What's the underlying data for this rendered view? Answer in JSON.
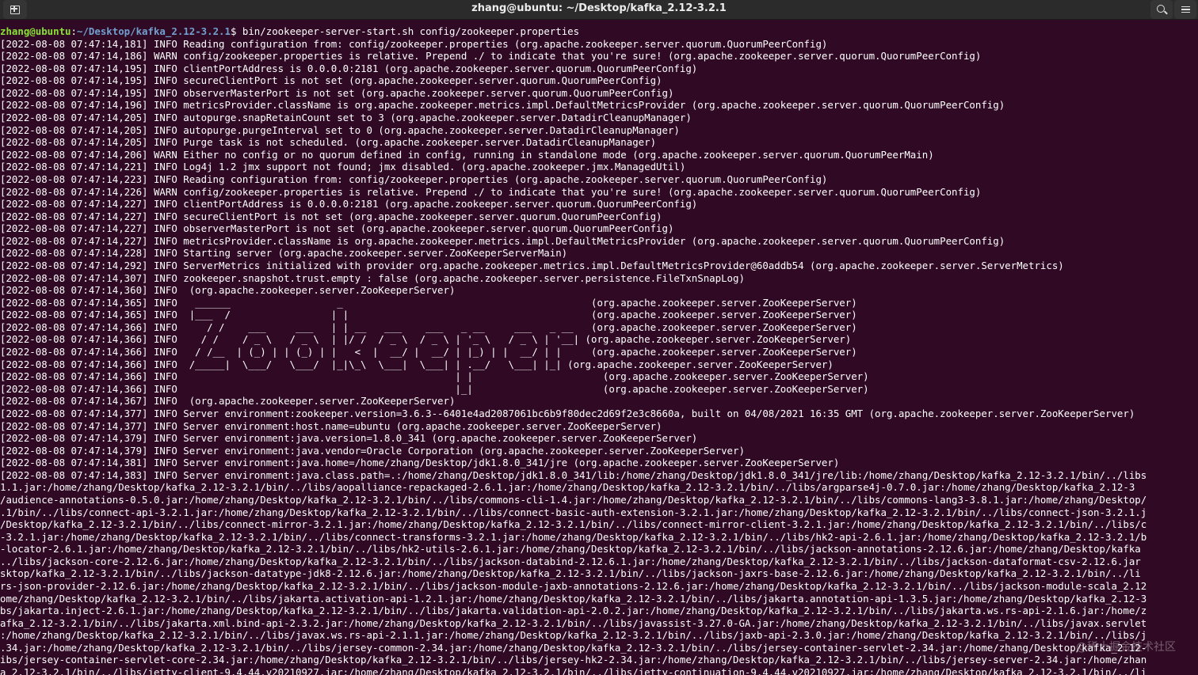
{
  "window": {
    "title": "zhang@ubuntu: ~/Desktop/kafka_2.12-3.2.1",
    "new_tab_icon": "new-tab-icon",
    "search_icon": "search-icon",
    "menu_icon": "hamburger-menu-icon"
  },
  "prompt": {
    "user_host": "zhang@ubuntu",
    "separator": ":",
    "path": "~/Desktop/kafka_2.12-3.2.1",
    "symbol": "$ ",
    "command": "bin/zookeeper-server-start.sh config/zookeeper.properties"
  },
  "colors": {
    "background": "#300a24",
    "prompt_user": "#8ae234",
    "prompt_path": "#729fcf",
    "text": "#ffffff"
  },
  "output_lines": [
    "[2022-08-08 07:47:14,181] INFO Reading configuration from: config/zookeeper.properties (org.apache.zookeeper.server.quorum.QuorumPeerConfig)",
    "[2022-08-08 07:47:14,186] WARN config/zookeeper.properties is relative. Prepend ./ to indicate that you're sure! (org.apache.zookeeper.server.quorum.QuorumPeerConfig)",
    "[2022-08-08 07:47:14,195] INFO clientPortAddress is 0.0.0.0:2181 (org.apache.zookeeper.server.quorum.QuorumPeerConfig)",
    "[2022-08-08 07:47:14,195] INFO secureClientPort is not set (org.apache.zookeeper.server.quorum.QuorumPeerConfig)",
    "[2022-08-08 07:47:14,195] INFO observerMasterPort is not set (org.apache.zookeeper.server.quorum.QuorumPeerConfig)",
    "[2022-08-08 07:47:14,196] INFO metricsProvider.className is org.apache.zookeeper.metrics.impl.DefaultMetricsProvider (org.apache.zookeeper.server.quorum.QuorumPeerConfig)",
    "[2022-08-08 07:47:14,205] INFO autopurge.snapRetainCount set to 3 (org.apache.zookeeper.server.DatadirCleanupManager)",
    "[2022-08-08 07:47:14,205] INFO autopurge.purgeInterval set to 0 (org.apache.zookeeper.server.DatadirCleanupManager)",
    "[2022-08-08 07:47:14,205] INFO Purge task is not scheduled. (org.apache.zookeeper.server.DatadirCleanupManager)",
    "[2022-08-08 07:47:14,206] WARN Either no config or no quorum defined in config, running in standalone mode (org.apache.zookeeper.server.quorum.QuorumPeerMain)",
    "[2022-08-08 07:47:14,221] INFO Log4j 1.2 jmx support not found; jmx disabled. (org.apache.zookeeper.jmx.ManagedUtil)",
    "[2022-08-08 07:47:14,223] INFO Reading configuration from: config/zookeeper.properties (org.apache.zookeeper.server.quorum.QuorumPeerConfig)",
    "[2022-08-08 07:47:14,226] WARN config/zookeeper.properties is relative. Prepend ./ to indicate that you're sure! (org.apache.zookeeper.server.quorum.QuorumPeerConfig)",
    "[2022-08-08 07:47:14,227] INFO clientPortAddress is 0.0.0.0:2181 (org.apache.zookeeper.server.quorum.QuorumPeerConfig)",
    "[2022-08-08 07:47:14,227] INFO secureClientPort is not set (org.apache.zookeeper.server.quorum.QuorumPeerConfig)",
    "[2022-08-08 07:47:14,227] INFO observerMasterPort is not set (org.apache.zookeeper.server.quorum.QuorumPeerConfig)",
    "[2022-08-08 07:47:14,227] INFO metricsProvider.className is org.apache.zookeeper.metrics.impl.DefaultMetricsProvider (org.apache.zookeeper.server.quorum.QuorumPeerConfig)",
    "[2022-08-08 07:47:14,228] INFO Starting server (org.apache.zookeeper.server.ZooKeeperServerMain)",
    "[2022-08-08 07:47:14,292] INFO ServerMetrics initialized with provider org.apache.zookeeper.metrics.impl.DefaultMetricsProvider@60addb54 (org.apache.zookeeper.server.ServerMetrics)",
    "[2022-08-08 07:47:14,307] INFO zookeeper.snapshot.trust.empty : false (org.apache.zookeeper.server.persistence.FileTxnSnapLog)",
    "[2022-08-08 07:47:14,360] INFO  (org.apache.zookeeper.server.ZooKeeperServer)",
    "[2022-08-08 07:47:14,365] INFO   ______                  _                                          (org.apache.zookeeper.server.ZooKeeperServer)",
    "[2022-08-08 07:47:14,365] INFO  |___  /                 | |                                         (org.apache.zookeeper.server.ZooKeeperServer)",
    "[2022-08-08 07:47:14,366] INFO     / /    ___     ___   | | __   ___    ___   _ __     ___   _ __   (org.apache.zookeeper.server.ZooKeeperServer)",
    "[2022-08-08 07:47:14,366] INFO    / /    / _ \\   / _ \\  | |/ /  / _ \\  / _ \\ | '_ \\   / _ \\ | '__| (org.apache.zookeeper.server.ZooKeeperServer)",
    "[2022-08-08 07:47:14,366] INFO   / /__  | (_) | | (_) | |   <  |  __/ |  __/ | |_) | |  __/ | |     (org.apache.zookeeper.server.ZooKeeperServer)",
    "[2022-08-08 07:47:14,366] INFO  /_____|  \\___/   \\___/  |_|\\_\\  \\___|  \\___| | .__/   \\___| |_| (org.apache.zookeeper.server.ZooKeeperServer)",
    "[2022-08-08 07:47:14,366] INFO                                               | |                      (org.apache.zookeeper.server.ZooKeeperServer)",
    "[2022-08-08 07:47:14,366] INFO                                               |_|                      (org.apache.zookeeper.server.ZooKeeperServer)",
    "[2022-08-08 07:47:14,367] INFO  (org.apache.zookeeper.server.ZooKeeperServer)",
    "[2022-08-08 07:47:14,377] INFO Server environment:zookeeper.version=3.6.3--6401e4ad2087061bc6b9f80dec2d69f2e3c8660a, built on 04/08/2021 16:35 GMT (org.apache.zookeeper.server.ZooKeeperServer)",
    "[2022-08-08 07:47:14,377] INFO Server environment:host.name=ubuntu (org.apache.zookeeper.server.ZooKeeperServer)",
    "[2022-08-08 07:47:14,379] INFO Server environment:java.version=1.8.0_341 (org.apache.zookeeper.server.ZooKeeperServer)",
    "[2022-08-08 07:47:14,379] INFO Server environment:java.vendor=Oracle Corporation (org.apache.zookeeper.server.ZooKeeperServer)",
    "[2022-08-08 07:47:14,381] INFO Server environment:java.home=/home/zhang/Desktop/jdk1.8.0_341/jre (org.apache.zookeeper.server.ZooKeeperServer)",
    "[2022-08-08 07:47:14,383] INFO Server environment:java.class.path=.:/home/zhang/Desktop/jdk1.8.0_341/lib:/home/zhang/Desktop/jdk1.8.0_341/jre/lib:/home/zhang/Desktop/kafka_2.12-3.2.1/bin/../libs",
    "1.1.jar:/home/zhang/Desktop/kafka_2.12-3.2.1/bin/../libs/aopalliance-repackaged-2.6.1.jar:/home/zhang/Desktop/kafka_2.12-3.2.1/bin/../libs/argparse4j-0.7.0.jar:/home/zhang/Desktop/kafka_2.12-3",
    "/audience-annotations-0.5.0.jar:/home/zhang/Desktop/kafka_2.12-3.2.1/bin/../libs/commons-cli-1.4.jar:/home/zhang/Desktop/kafka_2.12-3.2.1/bin/../libs/commons-lang3-3.8.1.jar:/home/zhang/Desktop/",
    ".1/bin/../libs/connect-api-3.2.1.jar:/home/zhang/Desktop/kafka_2.12-3.2.1/bin/../libs/connect-basic-auth-extension-3.2.1.jar:/home/zhang/Desktop/kafka_2.12-3.2.1/bin/../libs/connect-json-3.2.1.j",
    "/Desktop/kafka_2.12-3.2.1/bin/../libs/connect-mirror-3.2.1.jar:/home/zhang/Desktop/kafka_2.12-3.2.1/bin/../libs/connect-mirror-client-3.2.1.jar:/home/zhang/Desktop/kafka_2.12-3.2.1/bin/../libs/c",
    "-3.2.1.jar:/home/zhang/Desktop/kafka_2.12-3.2.1/bin/../libs/connect-transforms-3.2.1.jar:/home/zhang/Desktop/kafka_2.12-3.2.1/bin/../libs/hk2-api-2.6.1.jar:/home/zhang/Desktop/kafka_2.12-3.2.1/b",
    "-locator-2.6.1.jar:/home/zhang/Desktop/kafka_2.12-3.2.1/bin/../libs/hk2-utils-2.6.1.jar:/home/zhang/Desktop/kafka_2.12-3.2.1/bin/../libs/jackson-annotations-2.12.6.jar:/home/zhang/Desktop/kafka",
    "../libs/jackson-core-2.12.6.jar:/home/zhang/Desktop/kafka_2.12-3.2.1/bin/../libs/jackson-databind-2.12.6.1.jar:/home/zhang/Desktop/kafka_2.12-3.2.1/bin/../libs/jackson-dataformat-csv-2.12.6.jar",
    "sktop/kafka_2.12-3.2.1/bin/../libs/jackson-datatype-jdk8-2.12.6.jar:/home/zhang/Desktop/kafka_2.12-3.2.1/bin/../libs/jackson-jaxrs-base-2.12.6.jar:/home/zhang/Desktop/kafka_2.12-3.2.1/bin/../li",
    "rs-json-provider-2.12.6.jar:/home/zhang/Desktop/kafka_2.12-3.2.1/bin/../libs/jackson-module-jaxb-annotations-2.12.6.jar:/home/zhang/Desktop/kafka_2.12-3.2.1/bin/../libs/jackson-module-scala_2.12",
    "ome/zhang/Desktop/kafka_2.12-3.2.1/bin/../libs/jakarta.activation-api-1.2.1.jar:/home/zhang/Desktop/kafka_2.12-3.2.1/bin/../libs/jakarta.annotation-api-1.3.5.jar:/home/zhang/Desktop/kafka_2.12-3",
    "bs/jakarta.inject-2.6.1.jar:/home/zhang/Desktop/kafka_2.12-3.2.1/bin/../libs/jakarta.validation-api-2.0.2.jar:/home/zhang/Desktop/kafka_2.12-3.2.1/bin/../libs/jakarta.ws.rs-api-2.1.6.jar:/home/z",
    "afka_2.12-3.2.1/bin/../libs/jakarta.xml.bind-api-2.3.2.jar:/home/zhang/Desktop/kafka_2.12-3.2.1/bin/../libs/javassist-3.27.0-GA.jar:/home/zhang/Desktop/kafka_2.12-3.2.1/bin/../libs/javax.servlet",
    ":/home/zhang/Desktop/kafka_2.12-3.2.1/bin/../libs/javax.ws.rs-api-2.1.1.jar:/home/zhang/Desktop/kafka_2.12-3.2.1/bin/../libs/jaxb-api-2.3.0.jar:/home/zhang/Desktop/kafka_2.12-3.2.1/bin/../libs/j",
    ".34.jar:/home/zhang/Desktop/kafka_2.12-3.2.1/bin/../libs/jersey-common-2.34.jar:/home/zhang/Desktop/kafka_2.12-3.2.1/bin/../libs/jersey-container-servlet-2.34.jar:/home/zhang/Desktop/kafka_2.12-",
    "ibs/jersey-container-servlet-core-2.34.jar:/home/zhang/Desktop/kafka_2.12-3.2.1/bin/../libs/jersey-hk2-2.34.jar:/home/zhang/Desktop/kafka_2.12-3.2.1/bin/../libs/jersey-server-2.34.jar:/home/zhan",
    "a_2.12-3.2.1/bin/../libs/jetty-client-9.4.44.v20210927.jar:/home/zhang/Desktop/kafka_2.12-3.2.1/bin/../libs/jetty-continuation-9.4.44.v20210927.jar:/home/zhang/Desktop/kafka_2.12-3.2.1/bin/../li"
  ]
}
